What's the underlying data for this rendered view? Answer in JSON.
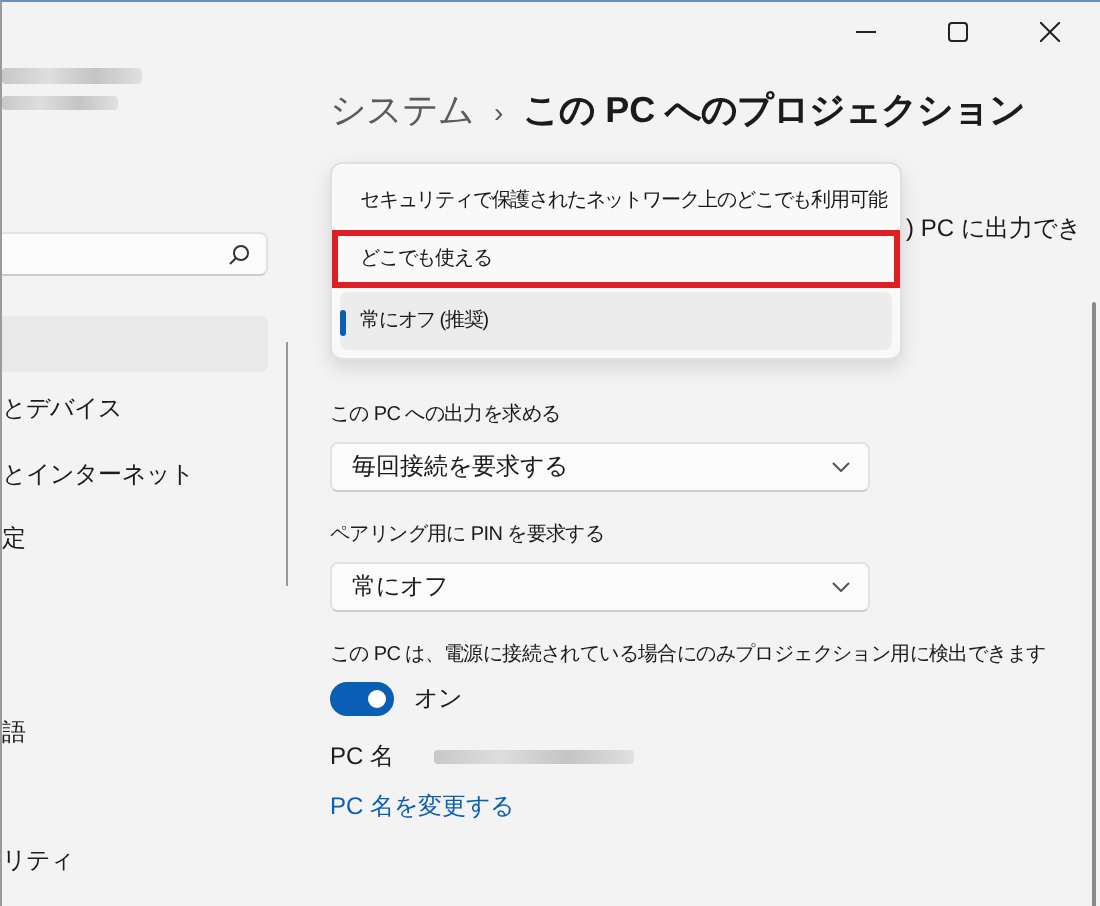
{
  "breadcrumb": {
    "parent": "システム",
    "separator": "›",
    "current": "この PC へのプロジェクション"
  },
  "sidebar": {
    "items": [
      {
        "label": "とデバイス"
      },
      {
        "label": "とインターネット"
      },
      {
        "label": "定"
      },
      {
        "label": "語"
      },
      {
        "label": "リティ"
      }
    ]
  },
  "first_setting": {
    "partial_text": ") PC に出力でき"
  },
  "popup_menu": {
    "items": [
      {
        "label": "セキュリティで保護されたネットワーク上のどこでも利用可能",
        "selected": false,
        "highlighted": false
      },
      {
        "label": "どこでも使える",
        "selected": false,
        "highlighted": true
      },
      {
        "label": "常にオフ (推奨)",
        "selected": true,
        "highlighted": false
      }
    ]
  },
  "settings": [
    {
      "kind": "dropdown",
      "label": "この PC への出力を求める",
      "value": "毎回接続を要求する"
    },
    {
      "kind": "dropdown",
      "label": "ペアリング用に PIN を要求する",
      "value": "常にオフ"
    },
    {
      "kind": "toggle",
      "label": "この PC は、電源に接続されている場合にのみプロジェクション用に検出できます",
      "on": true,
      "state_text": "オン"
    }
  ],
  "pc_name": {
    "label": "PC 名",
    "link": "PC 名を変更する"
  }
}
